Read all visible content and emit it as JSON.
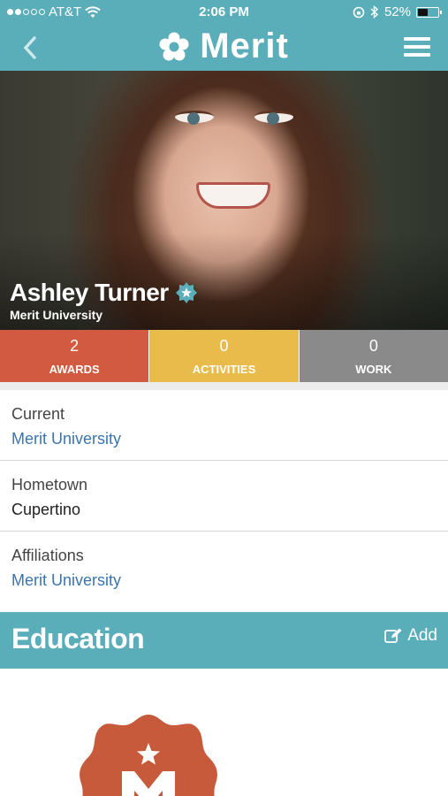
{
  "status_bar": {
    "carrier": "AT&T",
    "time": "2:06 PM",
    "battery_percent": "52%",
    "battery_level": 0.52,
    "icons": [
      "signal-dots-icon",
      "wifi-icon",
      "rotation-lock-icon",
      "bluetooth-icon",
      "battery-icon"
    ]
  },
  "nav": {
    "logo_text": "Merit",
    "icons": [
      "back-chevron-icon",
      "merit-logo-icon",
      "hamburger-menu-icon"
    ]
  },
  "profile": {
    "name": "Ashley Turner",
    "school": "Merit University",
    "verified_icon": "verified-star-icon"
  },
  "stats": [
    {
      "count": "2",
      "label": "AWARDS",
      "color": "#d15a40"
    },
    {
      "count": "0",
      "label": "ACTIVITIES",
      "color": "#e9bb4b"
    },
    {
      "count": "0",
      "label": "WORK",
      "color": "#8a8a8a"
    }
  ],
  "info": [
    {
      "label": "Current",
      "value": "Merit University",
      "is_link": true
    },
    {
      "label": "Hometown",
      "value": "Cupertino",
      "is_link": false
    },
    {
      "label": "Affiliations",
      "value": "Merit University",
      "is_link": true
    }
  ],
  "education": {
    "title": "Education",
    "add_label": "Add",
    "add_icon": "edit-icon",
    "badge_icon": "merit-m-badge-icon"
  },
  "colors": {
    "brand_teal": "#5aaeb9",
    "link_blue": "#3b74b0",
    "badge_red": "#c85a3c"
  }
}
